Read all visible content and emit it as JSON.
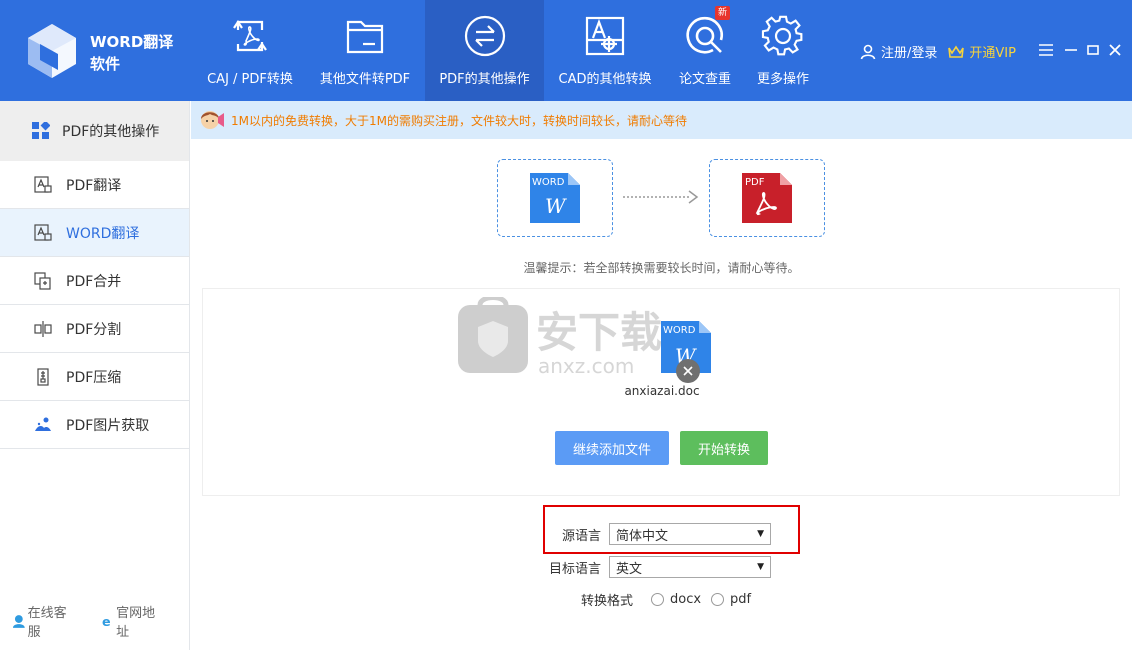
{
  "app": {
    "name_line1": "WORD翻译",
    "name_line2": "软件"
  },
  "nav": [
    {
      "label": "CAJ / PDF转换",
      "icon": "caj-pdf-icon"
    },
    {
      "label": "其他文件转PDF",
      "icon": "folder-icon"
    },
    {
      "label": "PDF的其他操作",
      "icon": "swap-arrows-icon",
      "active": true
    },
    {
      "label": "CAD的其他转换",
      "icon": "cad-icon"
    },
    {
      "label": "论文查重",
      "icon": "thesis-check-icon",
      "badge": "新"
    },
    {
      "label": "更多操作",
      "icon": "gear-icon"
    }
  ],
  "user": {
    "login_label": "注册/登录",
    "vip_label": "开通VIP"
  },
  "sidebar": {
    "header": "PDF的其他操作",
    "items": [
      {
        "label": "PDF翻译"
      },
      {
        "label": "WORD翻译",
        "active": true
      },
      {
        "label": "PDF合并"
      },
      {
        "label": "PDF分割"
      },
      {
        "label": "PDF压缩"
      },
      {
        "label": "PDF图片获取"
      }
    ],
    "footer": {
      "service_label": "在线客服",
      "website_label": "官网地址"
    }
  },
  "notice": "1M以内的免费转换，大于1M的需购买注册，文件较大时，转换时间较长，请耐心等待",
  "conversion": {
    "from_label": "WORD",
    "to_label": "PDF",
    "tip": "温馨提示：若全部转换需要较长时间，请耐心等待。"
  },
  "watermark": {
    "text": "安下载",
    "sub": "anxz.com"
  },
  "file": {
    "badge": "WORD",
    "name": "anxiazai.doc"
  },
  "buttons": {
    "add_label": "继续添加文件",
    "start_label": "开始转换"
  },
  "options": {
    "source_label": "源语言",
    "source_value": "简体中文",
    "target_label": "目标语言",
    "target_value": "英文",
    "format_label": "转换格式",
    "formats": [
      "docx",
      "pdf"
    ]
  },
  "colors": {
    "primary": "#2f6fde",
    "primary_dark": "#2a5fc4",
    "notice_bg": "#d9ebfc",
    "notice_text": "#f07c00",
    "vip": "#f7d33c",
    "add_button": "#5b9bf5",
    "start_button": "#5dbe5d",
    "highlight": "#e00000"
  }
}
